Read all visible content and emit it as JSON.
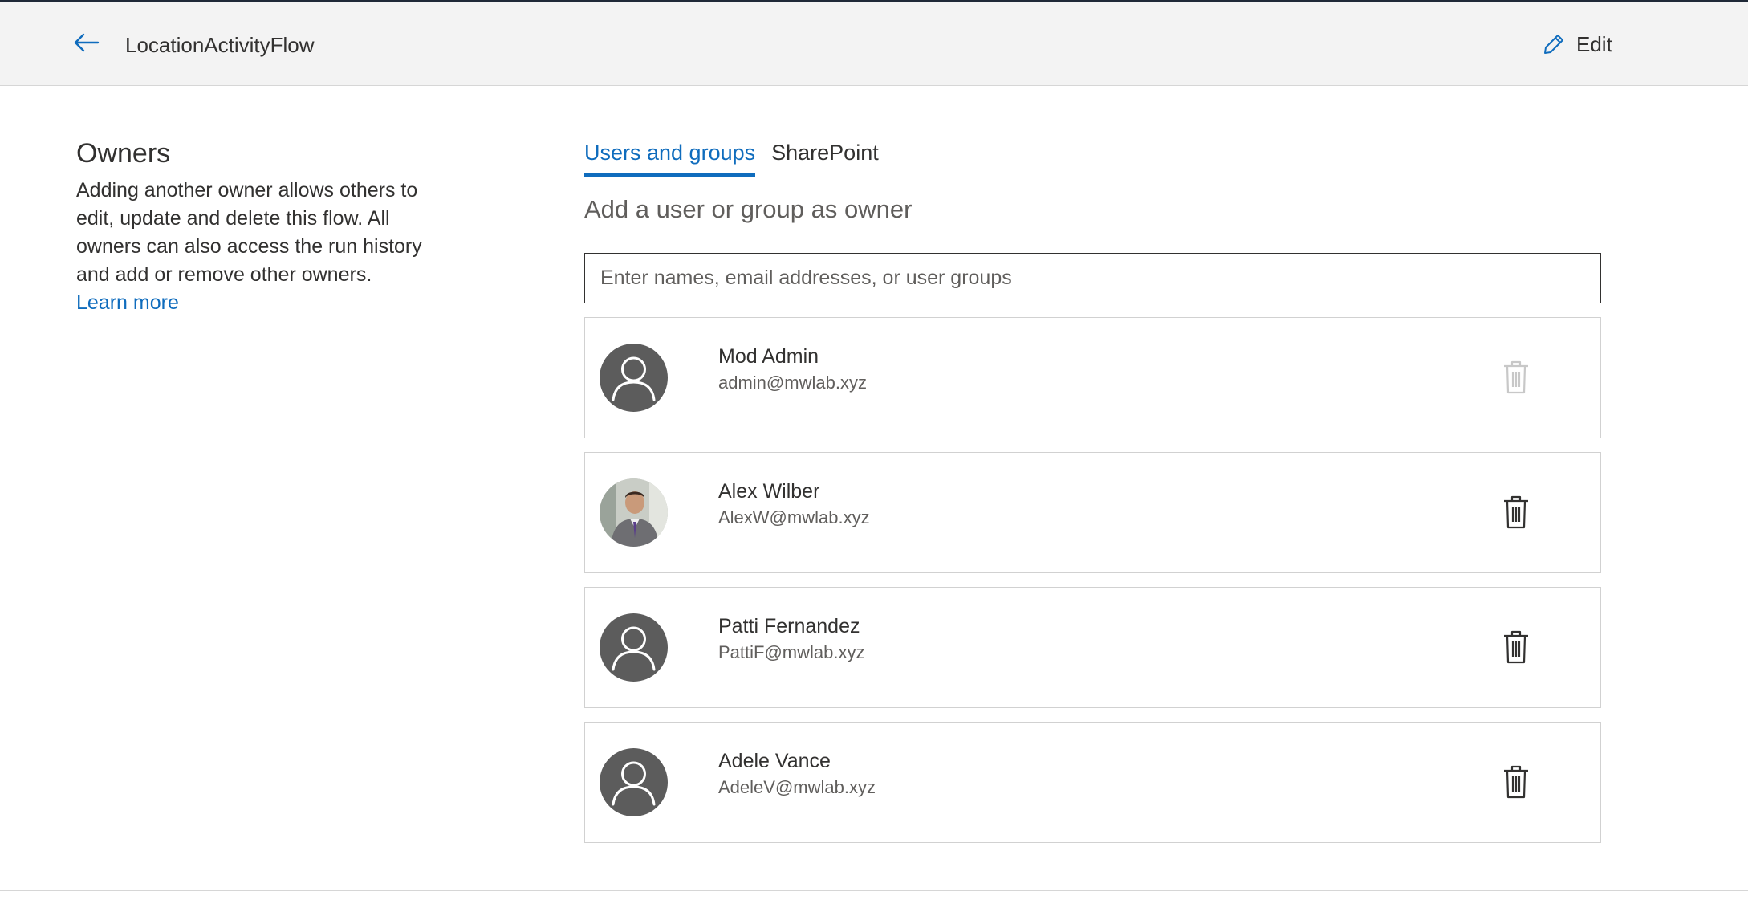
{
  "header": {
    "title": "LocationActivityFlow",
    "edit_label": "Edit",
    "back_icon": "arrow-left-icon",
    "edit_icon": "pencil-icon"
  },
  "owners_panel": {
    "title": "Owners",
    "description": "Adding another owner allows others to edit, update and delete this flow. All owners can also access the run history and add or remove other owners.",
    "learn_more": "Learn more"
  },
  "tabs": [
    {
      "label": "Users and groups",
      "active": true
    },
    {
      "label": "SharePoint",
      "active": false
    }
  ],
  "add_owner": {
    "heading": "Add a user or group as owner",
    "placeholder": "Enter names, email addresses, or user groups",
    "value": ""
  },
  "owners": [
    {
      "name": "Mod Admin",
      "email": "admin@mwlab.xyz",
      "avatar": "default-person-icon",
      "delete_enabled": false
    },
    {
      "name": "Alex Wilber",
      "email": "AlexW@mwlab.xyz",
      "avatar": "profile-photo",
      "delete_enabled": true
    },
    {
      "name": "Patti Fernandez",
      "email": "PattiF@mwlab.xyz",
      "avatar": "default-person-icon",
      "delete_enabled": true
    },
    {
      "name": "Adele Vance",
      "email": "AdeleV@mwlab.xyz",
      "avatar": "default-person-icon",
      "delete_enabled": true
    }
  ],
  "colors": {
    "accent": "#0f6cbd",
    "header_bg": "#f3f3f3",
    "avatar_bg": "#5c5c5c",
    "disabled_icon": "#c8c8c8",
    "text": "#323130"
  }
}
